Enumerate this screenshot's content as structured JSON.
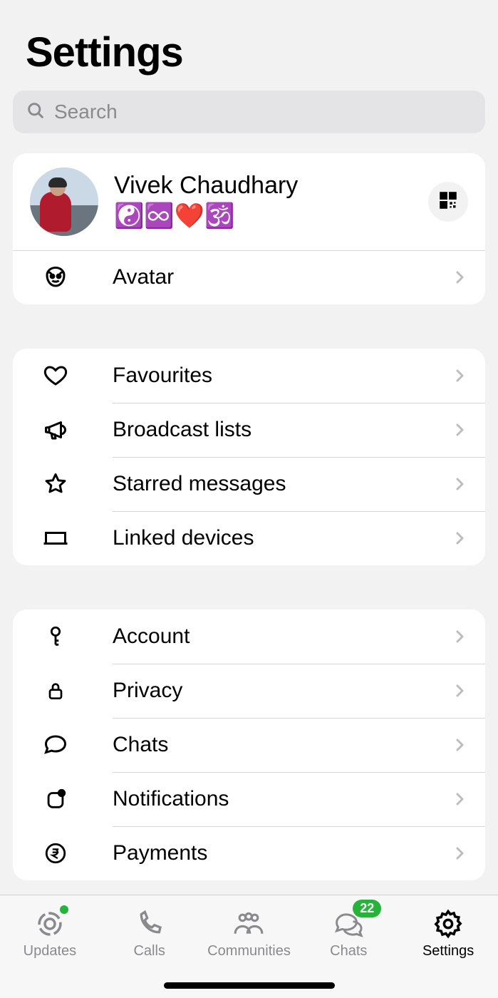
{
  "page_title": "Settings",
  "search": {
    "placeholder": "Search"
  },
  "profile": {
    "name": "Vivek Chaudhary",
    "status": "☯️♾️❤️🕉️"
  },
  "avatar_row": {
    "label": "Avatar"
  },
  "group1": [
    {
      "key": "favourites",
      "label": "Favourites"
    },
    {
      "key": "broadcast",
      "label": "Broadcast lists"
    },
    {
      "key": "starred",
      "label": "Starred messages"
    },
    {
      "key": "linked",
      "label": "Linked devices"
    }
  ],
  "group2": [
    {
      "key": "account",
      "label": "Account"
    },
    {
      "key": "privacy",
      "label": "Privacy"
    },
    {
      "key": "chats",
      "label": "Chats"
    },
    {
      "key": "notifications",
      "label": "Notifications"
    },
    {
      "key": "payments",
      "label": "Payments"
    }
  ],
  "tabs": {
    "updates": {
      "label": "Updates"
    },
    "calls": {
      "label": "Calls"
    },
    "communities": {
      "label": "Communities"
    },
    "chats": {
      "label": "Chats",
      "badge": "22"
    },
    "settings": {
      "label": "Settings"
    }
  }
}
